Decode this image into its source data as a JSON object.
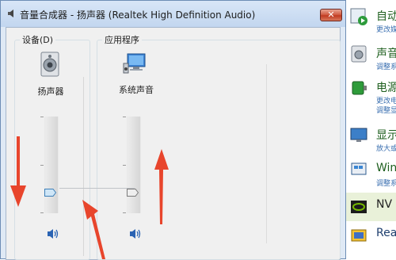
{
  "window": {
    "title": "音量合成器 - 扬声器 (Realtek High Definition Audio)",
    "close_glyph": "✕"
  },
  "device_group": {
    "label": "设备(D)",
    "channel": {
      "name": "扬声器",
      "volume": 0.21,
      "icon": "speaker-icon"
    }
  },
  "apps_group": {
    "label": "应用程序",
    "channel": {
      "name": "系统声音",
      "volume": 0.21,
      "icon": "system-sounds-icon"
    }
  },
  "control_panel": {
    "items": [
      {
        "title": "自动",
        "sub": "更改媒",
        "icon": "autoplay-icon"
      },
      {
        "title": "声音",
        "sub": "调整系",
        "icon": "speaker-icon"
      },
      {
        "title": "电源",
        "sub": "更改电",
        "sub2": "调整显",
        "icon": "power-icon"
      },
      {
        "title": "显示",
        "sub": "放大或",
        "icon": "display-icon"
      },
      {
        "title": "Win",
        "sub": "调整系",
        "icon": "windows-update-icon"
      },
      {
        "title": "NV",
        "sub": "",
        "icon": "nvidia-icon"
      },
      {
        "title": "Rea",
        "sub": "",
        "icon": "realtek-icon"
      }
    ]
  },
  "colors": {
    "accent_red_arrow": "#e8452c",
    "link_green": "#1e5f1e",
    "link_blue": "#3a6fb0"
  }
}
